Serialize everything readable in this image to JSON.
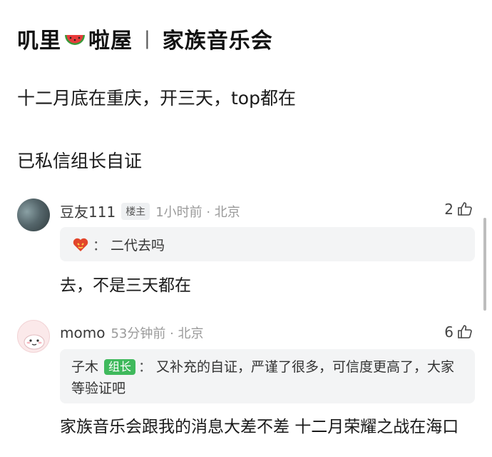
{
  "header": {
    "title_left_a": "叽里",
    "title_emoji": "watermelon-emoji",
    "title_left_b": "啦屋",
    "separator": "|",
    "title_right": "家族音乐会"
  },
  "post": {
    "line1": "十二月底在重庆，开三天，top都在",
    "line2": "已私信组长自证"
  },
  "comments": [
    {
      "user": "豆友111",
      "badge": "楼主",
      "time": "1小时前 · 北京",
      "likes": "2",
      "quote": {
        "icon": "heart-eyes-emoji",
        "colon": "：",
        "text": "二代去吗"
      },
      "reply": "去，不是三天都在"
    },
    {
      "user": "momo",
      "time": "53分钟前 · 北京",
      "likes": "6",
      "quote": {
        "author": "子木",
        "tag": "组长",
        "colon": "：",
        "text": "又补充的自证，严谨了很多，可信度更高了，大家等验证吧"
      },
      "reply": "家族音乐会跟我的消息大差不差 十二月荣耀之战在海口"
    }
  ],
  "colors": {
    "leader_tag": "#3fb95c",
    "quote_bg": "#f3f4f5"
  }
}
